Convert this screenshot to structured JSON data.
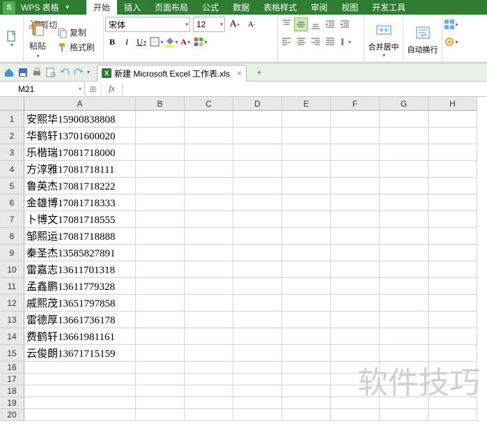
{
  "app": {
    "icon_letter": "S",
    "name": "WPS 表格"
  },
  "tabs": [
    "开始",
    "插入",
    "页面布局",
    "公式",
    "数据",
    "表格样式",
    "审阅",
    "视图",
    "开发工具"
  ],
  "active_tab": 0,
  "clipboard": {
    "cut": "剪切",
    "copy": "复制",
    "format_painter": "格式刷",
    "paste": "粘贴"
  },
  "font": {
    "name": "宋体",
    "size": "12"
  },
  "merge": {
    "label": "合并居中"
  },
  "wrap": {
    "label": "自动换行"
  },
  "doc": {
    "name": "新建 Microsoft Excel 工作表.xls"
  },
  "namebox": {
    "value": "M21"
  },
  "fx": {
    "label": "fx"
  },
  "columns": [
    "A",
    "B",
    "C",
    "D",
    "E",
    "F",
    "G",
    "H"
  ],
  "rows_data": [
    "安熙华15900838808",
    "华鹤轩13701600020",
    "乐楷瑞17081718000",
    "方淳雅17081718111",
    "鲁英杰17081718222",
    "金雄博17081718333",
    "卜博文17081718555",
    "邹熙运17081718888",
    "秦圣杰13585827891",
    "雷嘉志13611701318",
    "孟鑫鹏13611779328",
    "戚熙茂13651797858",
    "雷德厚13661736178",
    "费鹤轩13661981161",
    "云俊朗13671715159"
  ],
  "empty_rows": [
    16,
    17,
    18,
    19,
    20
  ],
  "watermark": "软件技巧"
}
